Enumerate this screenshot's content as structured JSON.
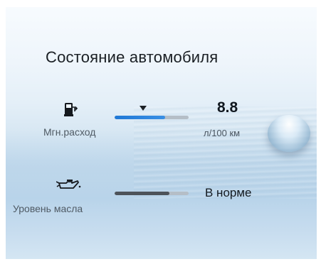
{
  "title": "Состояние автомобиля",
  "fuel": {
    "icon": "fuel-pump-icon",
    "label": "Мгн.расход",
    "value": "8.8",
    "unit": "л/100 км",
    "bar_level": 0.68,
    "marker_level": 0.38
  },
  "oil": {
    "icon": "oil-can-icon",
    "label": "Уровень масла",
    "status": "В норме",
    "bar_level": 0.74
  },
  "colors": {
    "accent": "#1f78d6",
    "bar_track": "#b5bec7",
    "bar_dark": "#4d535a"
  }
}
